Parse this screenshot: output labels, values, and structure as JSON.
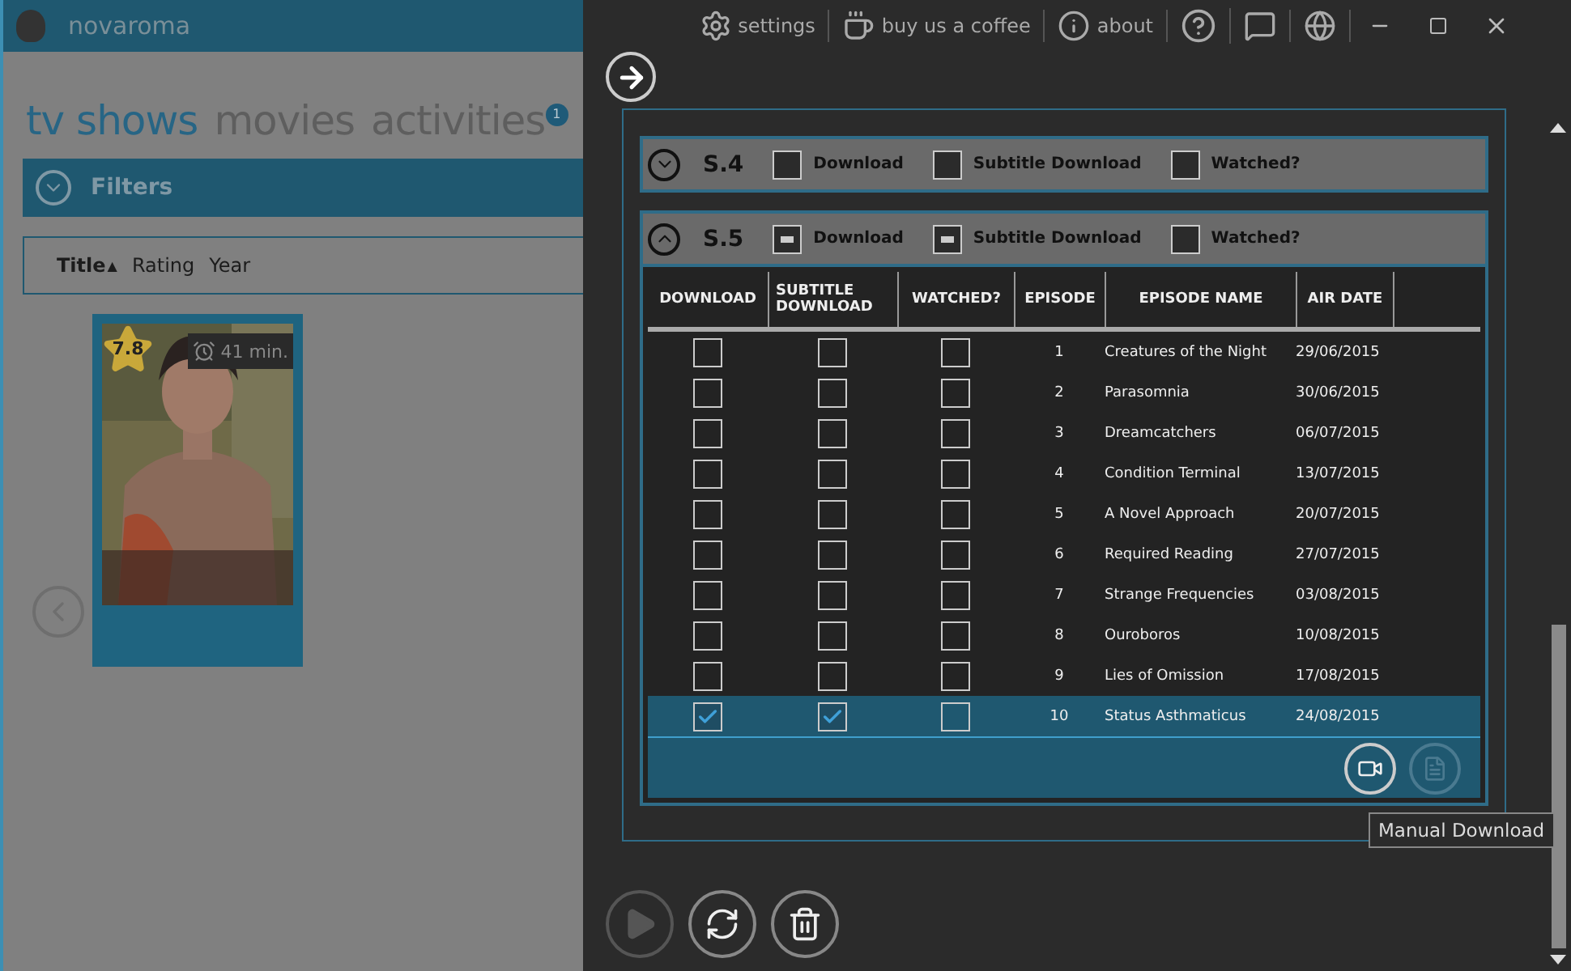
{
  "app": {
    "title": "novaroma"
  },
  "nav_tabs": [
    {
      "label": "tv shows",
      "selected": true
    },
    {
      "label": "movies",
      "selected": false
    },
    {
      "label": "activities",
      "selected": false,
      "badge": "1"
    }
  ],
  "filters": {
    "label": "Filters",
    "expanded": false
  },
  "sort_options": [
    {
      "label": "Title",
      "selected": true,
      "indicator": "▲"
    },
    {
      "label": "Rating",
      "selected": false
    },
    {
      "label": "Year",
      "selected": false
    }
  ],
  "shows": [
    {
      "kind": "picture",
      "rating": "7.8",
      "runtime": "41 min.",
      "selected": true
    }
  ],
  "toolbar": [
    {
      "kind": "settings",
      "label": "settings"
    },
    {
      "kind": "coffee",
      "label": "buy us a coffee"
    },
    {
      "kind": "about",
      "label": "about"
    },
    {
      "kind": "help"
    },
    {
      "kind": "chat"
    },
    {
      "kind": "globe"
    }
  ],
  "seasons": [
    {
      "label": "S.4",
      "expanded": false,
      "checks": [
        {
          "label": "Download",
          "partial": false
        },
        {
          "label": "Subtitle Download",
          "partial": false
        },
        {
          "label": "Watched?",
          "partial": false
        }
      ]
    },
    {
      "label": "S.5",
      "expanded": true,
      "checks": [
        {
          "label": "Download",
          "partial": true
        },
        {
          "label": "Subtitle Download",
          "partial": true
        },
        {
          "label": "Watched?",
          "partial": false
        }
      ]
    }
  ],
  "episode_table": {
    "columns": [
      "DOWNLOAD",
      "SUBTITLE DOWNLOAD",
      "WATCHED?",
      "EPISODE",
      "EPISODE NAME",
      "AIR DATE"
    ],
    "rows": [
      {
        "download": false,
        "subtitle": false,
        "watched": false,
        "episode": "1",
        "name": "Creatures of the Night",
        "air_date": "29/06/2015",
        "selected": false
      },
      {
        "download": false,
        "subtitle": false,
        "watched": false,
        "episode": "2",
        "name": "Parasomnia",
        "air_date": "30/06/2015",
        "selected": false
      },
      {
        "download": false,
        "subtitle": false,
        "watched": false,
        "episode": "3",
        "name": "Dreamcatchers",
        "air_date": "06/07/2015",
        "selected": false
      },
      {
        "download": false,
        "subtitle": false,
        "watched": false,
        "episode": "4",
        "name": "Condition Terminal",
        "air_date": "13/07/2015",
        "selected": false
      },
      {
        "download": false,
        "subtitle": false,
        "watched": false,
        "episode": "5",
        "name": "A Novel Approach",
        "air_date": "20/07/2015",
        "selected": false
      },
      {
        "download": false,
        "subtitle": false,
        "watched": false,
        "episode": "6",
        "name": "Required Reading",
        "air_date": "27/07/2015",
        "selected": false
      },
      {
        "download": false,
        "subtitle": false,
        "watched": false,
        "episode": "7",
        "name": "Strange Frequencies",
        "air_date": "03/08/2015",
        "selected": false
      },
      {
        "download": false,
        "subtitle": false,
        "watched": false,
        "episode": "8",
        "name": "Ouroboros",
        "air_date": "10/08/2015",
        "selected": false
      },
      {
        "download": false,
        "subtitle": false,
        "watched": false,
        "episode": "9",
        "name": "Lies of Omission",
        "air_date": "17/08/2015",
        "selected": false
      },
      {
        "download": true,
        "subtitle": true,
        "watched": false,
        "episode": "10",
        "name": "Status Asthmaticus",
        "air_date": "24/08/2015",
        "selected": true
      }
    ]
  },
  "episode_actions": [
    {
      "kind": "manual_download",
      "disabled": false
    },
    {
      "kind": "subtitle",
      "disabled": true
    }
  ],
  "tooltip": "Manual Download",
  "bottom_actions": [
    {
      "kind": "play",
      "disabled": true
    },
    {
      "kind": "refresh",
      "disabled": false
    },
    {
      "kind": "delete",
      "disabled": false
    }
  ]
}
